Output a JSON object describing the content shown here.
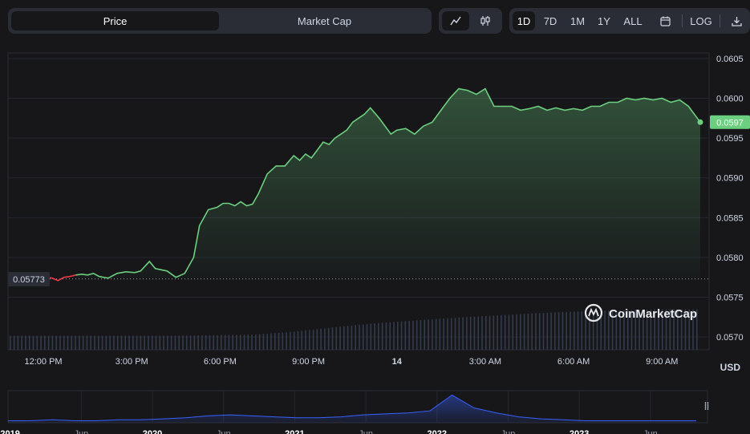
{
  "toolbar": {
    "price_label": "Price",
    "market_cap_label": "Market Cap",
    "ranges": [
      "1D",
      "7D",
      "1M",
      "1Y",
      "ALL"
    ],
    "active_range": "1D",
    "log_label": "LOG",
    "icons": {
      "line": "line-chart-icon",
      "candle": "candlestick-icon",
      "calendar": "calendar-icon",
      "download": "download-icon"
    }
  },
  "watermark": "CoinMarketCap",
  "currency": "USD",
  "colors": {
    "up": "#16c784",
    "line": "#6ccf7f",
    "down": "#ea3943",
    "nav_line": "#3861fb",
    "background": "#17171a",
    "price_badge": "#6ccf7f"
  },
  "chart_data": {
    "type": "line",
    "open_price_label": "0.05773",
    "open_price": 0.05773,
    "current_price_label": "0.0597",
    "current_price": 0.0597,
    "y_ticks": [
      "0.0605",
      "0.0600",
      "0.0595",
      "0.0590",
      "0.0585",
      "0.0580",
      "0.0575",
      "0.0570"
    ],
    "ylim": [
      0.05684,
      0.06057
    ],
    "x_ticks": [
      "12:00 PM",
      "3:00 PM",
      "6:00 PM",
      "9:00 PM",
      "14",
      "3:00 AM",
      "6:00 AM",
      "9:00 AM"
    ],
    "x_ticks_hours": [
      0,
      3,
      6,
      9,
      12,
      15,
      18,
      21
    ],
    "x_range_hours": [
      -1.2,
      22.6
    ],
    "series": [
      {
        "x_hours": [
          -0.2,
          0.1,
          0.3,
          0.5,
          0.7,
          0.9,
          1.1,
          1.3,
          1.5,
          1.7,
          1.9,
          2.2,
          2.5,
          2.8,
          3.1,
          3.3,
          3.6,
          3.8,
          4.2,
          4.5,
          4.8,
          5.1,
          5.3,
          5.6,
          5.9,
          6.1,
          6.3,
          6.5,
          6.7,
          6.9,
          7.1,
          7.3,
          7.6,
          7.9,
          8.2,
          8.5,
          8.7,
          8.9,
          9.1,
          9.3,
          9.5,
          9.7,
          9.9,
          10.1,
          10.3,
          10.5,
          10.7,
          10.9,
          11.1,
          11.4,
          11.6,
          11.8,
          12.0,
          12.3,
          12.6,
          12.9,
          13.2,
          13.5,
          13.8,
          14.1,
          14.4,
          14.7,
          15.0,
          15.3,
          15.6,
          15.9,
          16.2,
          16.5,
          16.8,
          17.1,
          17.4,
          17.7,
          18.0,
          18.3,
          18.6,
          18.9,
          19.2,
          19.5,
          19.8,
          20.1,
          20.4,
          20.7,
          21.0,
          21.3,
          21.6,
          21.9,
          22.1,
          22.3
        ],
        "values": [
          0.05773,
          0.05775,
          0.05774,
          0.05771,
          0.05775,
          0.05776,
          0.05778,
          0.05779,
          0.05778,
          0.0578,
          0.05776,
          0.05774,
          0.0578,
          0.05782,
          0.05781,
          0.05783,
          0.05795,
          0.05786,
          0.05783,
          0.05775,
          0.0578,
          0.058,
          0.0584,
          0.0586,
          0.05863,
          0.05868,
          0.05868,
          0.05865,
          0.0587,
          0.05865,
          0.05867,
          0.0588,
          0.05905,
          0.05915,
          0.05915,
          0.05928,
          0.05922,
          0.0593,
          0.05925,
          0.05935,
          0.05945,
          0.05942,
          0.0595,
          0.05955,
          0.0596,
          0.0597,
          0.05975,
          0.0598,
          0.05988,
          0.05975,
          0.05965,
          0.05955,
          0.0596,
          0.05962,
          0.05955,
          0.05965,
          0.0597,
          0.05985,
          0.06,
          0.06012,
          0.0601,
          0.06005,
          0.06012,
          0.0599,
          0.0599,
          0.0599,
          0.05985,
          0.05987,
          0.0599,
          0.05985,
          0.05988,
          0.05985,
          0.05987,
          0.05985,
          0.0599,
          0.0599,
          0.05995,
          0.05995,
          0.06,
          0.05998,
          0.06,
          0.05998,
          0.06,
          0.05995,
          0.05998,
          0.0599,
          0.0598,
          0.0597
        ]
      }
    ],
    "volume_relative": [
      0.25,
      0.25,
      0.25,
      0.25,
      0.25,
      0.26,
      0.27,
      0.32,
      0.4,
      0.47,
      0.52,
      0.57,
      0.61,
      0.65,
      0.68,
      0.7,
      0.72,
      0.72
    ],
    "navigator": {
      "x_ticks": [
        "2019",
        "Jun",
        "2020",
        "Jun",
        "2021",
        "Jun",
        "2022",
        "Jun",
        "2023",
        "Jun"
      ],
      "values": [
        0.02,
        0.02,
        0.03,
        0.02,
        0.02,
        0.03,
        0.03,
        0.04,
        0.05,
        0.07,
        0.08,
        0.07,
        0.06,
        0.05,
        0.05,
        0.06,
        0.08,
        0.09,
        0.1,
        0.12,
        0.28,
        0.15,
        0.1,
        0.06,
        0.04,
        0.03,
        0.02,
        0.02,
        0.02,
        0.02,
        0.02,
        0.02
      ]
    }
  }
}
